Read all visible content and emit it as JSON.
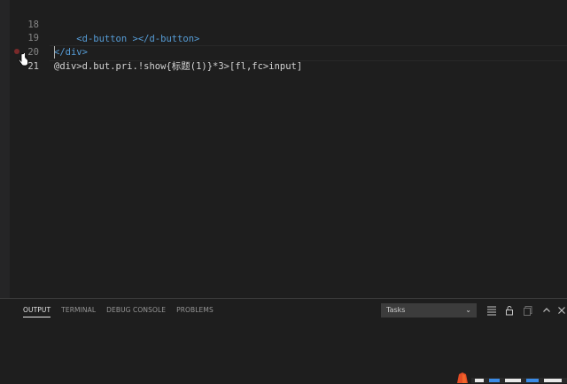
{
  "editor": {
    "lines": [
      {
        "number": "18",
        "indent": "    ",
        "open_tag": "<d-button >",
        "close_tag": "</d-button>"
      },
      {
        "number": "19",
        "indent": "",
        "close_tag": "</div>"
      },
      {
        "number": "20",
        "text": "@div>d.but.pri.!show{标题(1)}*3>[fl,fc>input]"
      },
      {
        "number": "21",
        "text": ""
      }
    ]
  },
  "panel": {
    "tabs": [
      "OUTPUT",
      "TERMINAL",
      "DEBUG CONSOLE",
      "PROBLEMS"
    ],
    "active_tab": "OUTPUT",
    "task_selector": {
      "value": "Tasks"
    }
  },
  "icons": [
    "list-filter-icon",
    "lock-icon",
    "copy-icon",
    "chevron-up-icon",
    "close-icon",
    "chevron-down-icon"
  ],
  "colors": {
    "background": "#1e1e1e",
    "line_number": "#858585",
    "tag": "#569cd6",
    "text": "#d4d4d4",
    "panel_border": "#3c3c3c",
    "brand_badge": "#e44d26"
  }
}
